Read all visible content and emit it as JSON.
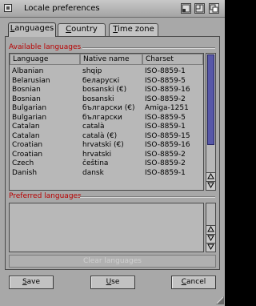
{
  "window": {
    "title": "Locale preferences"
  },
  "tabs": [
    {
      "label": "Languages",
      "underline": "L",
      "rest": "anguages"
    },
    {
      "label": "Country",
      "underline": "C",
      "rest": "ountry"
    },
    {
      "label": "Time zone",
      "underline": "T",
      "rest": "ime zone"
    }
  ],
  "available": {
    "label": "Available languages",
    "columns": [
      "Language",
      "Native name",
      "Charset"
    ],
    "rows": [
      [
        "Albanian",
        "shqip",
        "ISO-8859-1"
      ],
      [
        "Belarusian",
        "беларускі",
        "ISO-8859-5"
      ],
      [
        "Bosnian",
        "bosanski (€)",
        "ISO-8859-16"
      ],
      [
        "Bosnian",
        "bosanski",
        "ISO-8859-2"
      ],
      [
        "Bulgarian",
        "български (€)",
        "Amiga-1251"
      ],
      [
        "Bulgarian",
        "български",
        "ISO-8859-5"
      ],
      [
        "Catalan",
        "català",
        "ISO-8859-1"
      ],
      [
        "Catalan",
        "català (€)",
        "ISO-8859-15"
      ],
      [
        "Croatian",
        "hrvatski (€)",
        "ISO-8859-16"
      ],
      [
        "Croatian",
        "hrvatski",
        "ISO-8859-2"
      ],
      [
        "Czech",
        "čeština",
        "ISO-8859-2"
      ],
      [
        "Danish",
        "dansk",
        "ISO-8859-1"
      ]
    ],
    "scroll_position": 0.0,
    "scroll_visible_fraction": 0.77
  },
  "preferred": {
    "label": "Preferred languages",
    "rows": []
  },
  "buttons": {
    "clear": "Clear languages",
    "save": {
      "underline": "S",
      "rest": "ave"
    },
    "use": {
      "underline": "U",
      "rest": "se"
    },
    "cancel": {
      "underline": "C",
      "rest": "ancel"
    }
  },
  "colors": {
    "section_label": "#b80000",
    "scroll_thumb": "#5858a8"
  }
}
